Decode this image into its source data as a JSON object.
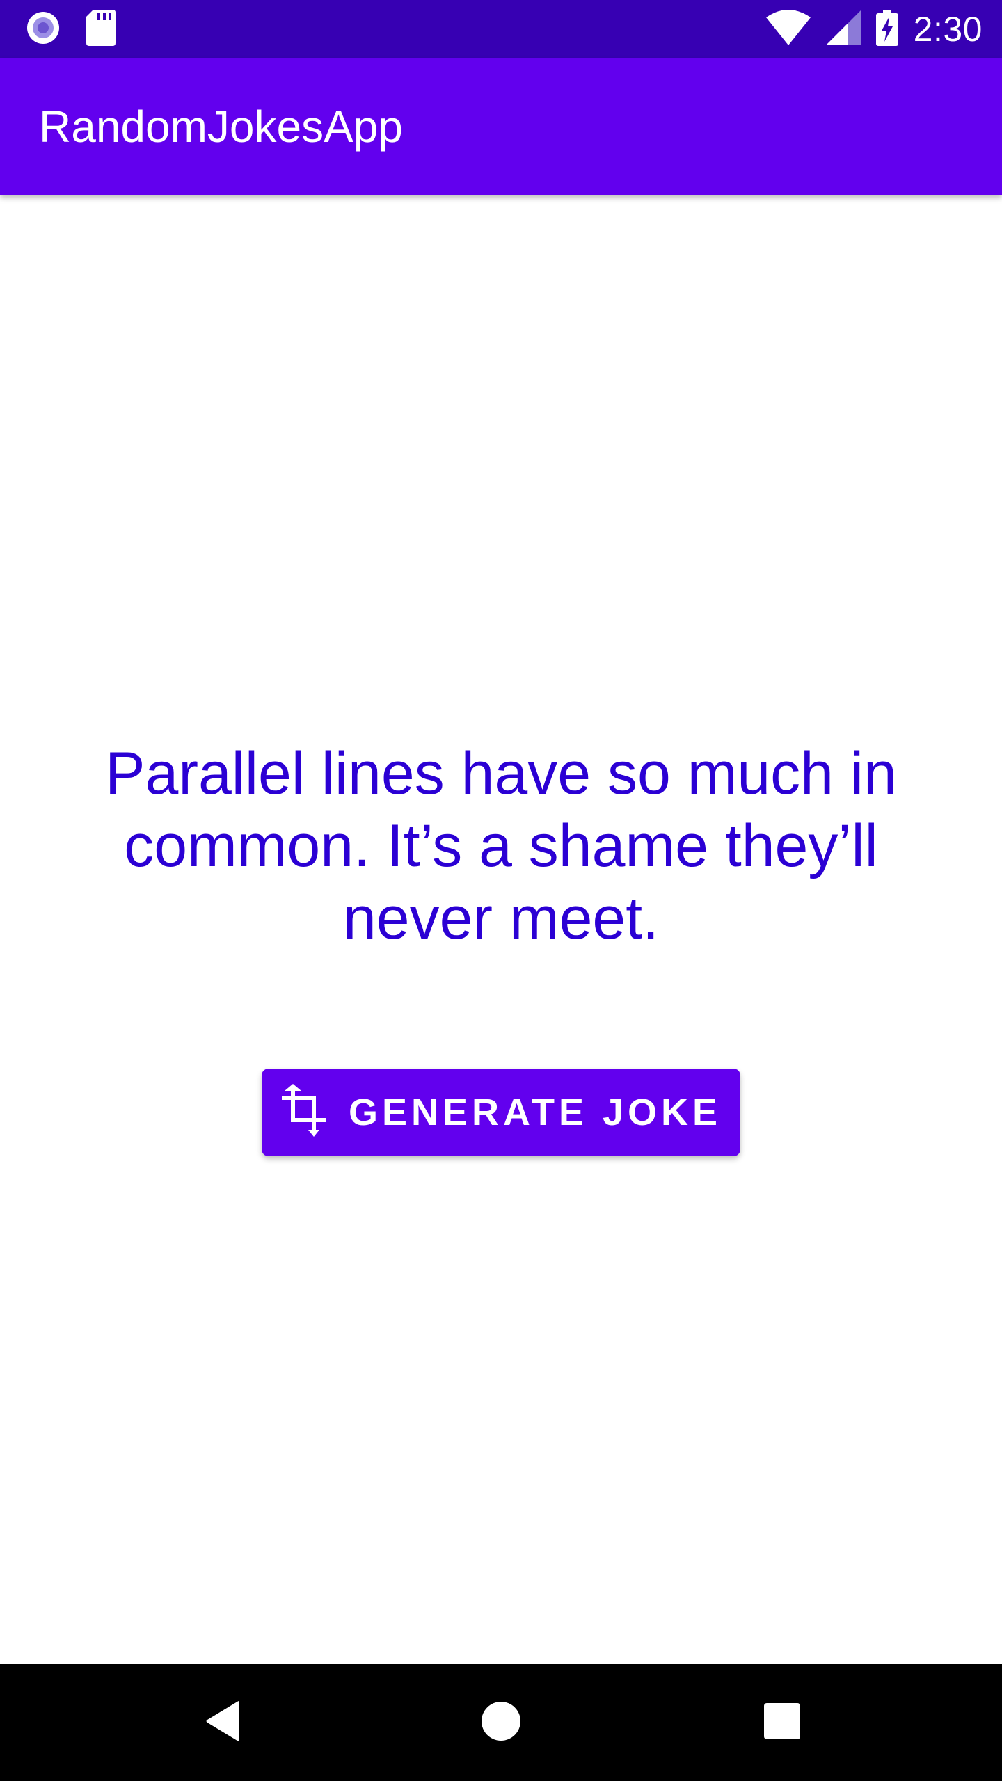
{
  "status_bar": {
    "time": "2:30",
    "icons": [
      "record-icon",
      "sd-card-icon",
      "wifi-icon",
      "signal-icon",
      "battery-charging-icon"
    ]
  },
  "app_bar": {
    "title": "RandomJokesApp"
  },
  "joke": {
    "text": "Parallel lines have so much in common. It’s a shame they’ll never meet."
  },
  "generate_button": {
    "label": "GENERATE JOKE",
    "icon": "crop-rotate-icon"
  },
  "nav_bar": {
    "buttons": [
      "back-icon",
      "home-icon",
      "recents-icon"
    ]
  },
  "colors": {
    "status_bar": "#3700b3",
    "primary": "#6200ee",
    "joke_text": "#2b00d4",
    "nav_bar": "#000000"
  }
}
